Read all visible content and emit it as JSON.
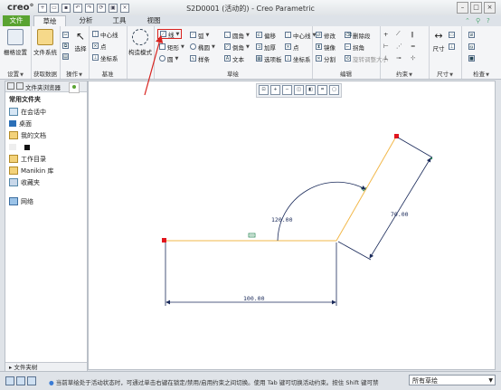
{
  "app": {
    "logo": "creo°",
    "window_title": "S2D0001 (活动的) - Creo Parametric"
  },
  "tabs": [
    {
      "label": "文件"
    },
    {
      "label": "草绘"
    },
    {
      "label": "分析"
    },
    {
      "label": "工具"
    },
    {
      "label": "视图"
    }
  ],
  "ribbon": {
    "setup": {
      "label": "设置",
      "sketch_setup": "栅格设置"
    },
    "get_data": {
      "label": "获取数据",
      "file_system": "文件系统"
    },
    "operations": {
      "label": "操作",
      "select": "选择"
    },
    "datum": {
      "label": "基准",
      "centerline": "中心线",
      "point": "点",
      "coord_sys": "坐标系"
    },
    "construction": {
      "mode": "构造模式"
    },
    "sketching": {
      "label": "草绘",
      "line": "线",
      "rectangle": "矩形",
      "circle": "圆",
      "arc": "弧",
      "ellipse": "椭圆",
      "spline": "样条",
      "fillet": "圆角",
      "chamfer": "倒角",
      "text": "文本",
      "offset": "偏移",
      "thicken": "加厚",
      "palette": "选项板",
      "centerline": "中心线",
      "point": "点",
      "coord_sys": "坐标系"
    },
    "editing": {
      "label": "编辑",
      "modify": "修改",
      "mirror": "镜像",
      "divide": "分割",
      "delete_segment": "删除段",
      "corner": "拐角",
      "rotate_resize": "旋转调整大小"
    },
    "constrain": {
      "label": "约束"
    },
    "dimension": {
      "label": "尺寸",
      "dim": "尺寸"
    },
    "inspect": {
      "label": "检查"
    }
  },
  "left_panel": {
    "tabs": [
      "文件夹浏览器",
      ""
    ],
    "common_folders_title": "常用文件夹",
    "items": [
      {
        "label": "在会话中",
        "icon": "session-icon"
      },
      {
        "label": "桌面",
        "icon": "desktop-icon"
      },
      {
        "label": "我的文档",
        "icon": "documents-icon"
      },
      {
        "label": "",
        "icon": "blank-icon"
      },
      {
        "label": "工作目录",
        "icon": "workdir-icon"
      },
      {
        "label": "Manikin 库",
        "icon": "manikin-icon"
      },
      {
        "label": "收藏夹",
        "icon": "favorites-icon"
      }
    ],
    "network": "网络",
    "footer": "文件夹树"
  },
  "sketch": {
    "dims": {
      "horizontal": "100.00",
      "angle": "120.00",
      "slanted": "70.00"
    }
  },
  "status": {
    "message": "当前草绘处于活动状态时，可通过单击右键在锁定/禁用/启用约束之间切换。使用 Tab 键可切换活动约束。按住 Shift 键可禁",
    "filter": "所有草绘"
  },
  "colors": {
    "green_tab": "#5aa331",
    "sketch_line": "#f2b84a",
    "dimension": "#1a2a5a",
    "endpoint": "#e2151d",
    "highlight": "#d8231f"
  }
}
